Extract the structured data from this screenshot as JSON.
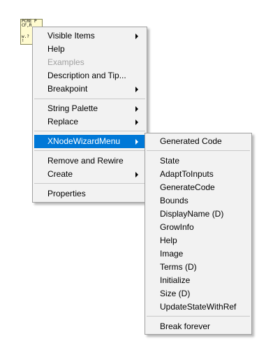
{
  "node_icon": {
    "header_text": "PCRE P\nCF,R",
    "body_text": "w.?\n!"
  },
  "main_menu": {
    "visible_items": "Visible Items",
    "help": "Help",
    "examples": "Examples",
    "description_and_tip": "Description and Tip...",
    "breakpoint": "Breakpoint",
    "string_palette": "String Palette",
    "replace": "Replace",
    "xnode_wizard_menu": "XNodeWizardMenu",
    "remove_and_rewire": "Remove and Rewire",
    "create": "Create",
    "properties": "Properties"
  },
  "sub_menu": {
    "generated_code": "Generated Code",
    "state": "State",
    "adapt_to_inputs": "AdaptToInputs",
    "generate_code": "GenerateCode",
    "bounds": "Bounds",
    "display_name": "DisplayName (D)",
    "grow_info": "GrowInfo",
    "help": "Help",
    "image": "Image",
    "terms": "Terms (D)",
    "initialize": "Initialize",
    "size": "Size (D)",
    "update_state_with_ref": "UpdateStateWithRef",
    "break_forever": "Break forever"
  },
  "colors": {
    "menu_background": "#f2f2f2",
    "highlight": "#0078d7",
    "disabled_text": "#a0a0a0",
    "node_background": "#fffbd0"
  }
}
